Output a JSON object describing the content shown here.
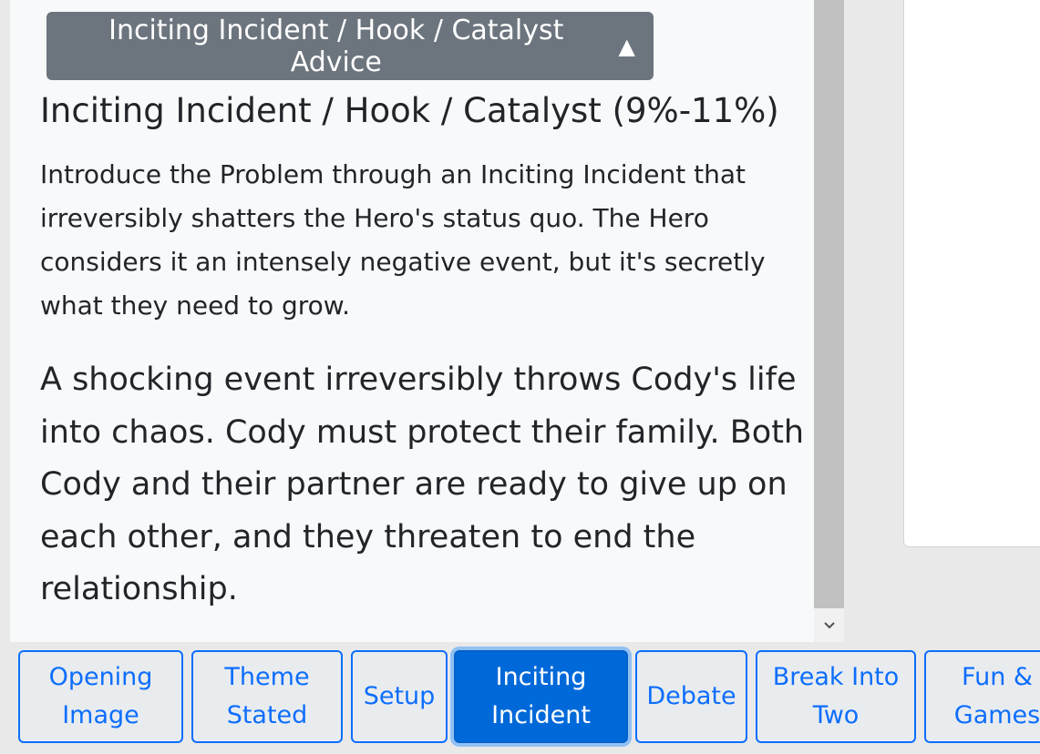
{
  "advice": {
    "button_label": "Inciting Incident / Hook / Catalyst Advice",
    "toggle_icon": "▲"
  },
  "section": {
    "heading": "Inciting Incident / Hook / Catalyst (9%-11%)",
    "description": "Introduce the Problem through an Inciting Incident that irreversibly shatters the Hero's status quo. The Hero considers it an intensely negative event, but it's secretly what they need to grow.",
    "story_text": "A shocking event irreversibly throws Cody's life into chaos. Cody must protect their family. Both Cody and their partner are ready to give up on each other, and they threaten to end the relationship."
  },
  "scrollbar": {
    "down_arrow": "⌄"
  },
  "beats": [
    {
      "label": "Opening Image",
      "active": false
    },
    {
      "label": "Theme Stated",
      "active": false
    },
    {
      "label": "Setup",
      "active": false
    },
    {
      "label": "Inciting Incident",
      "active": true
    },
    {
      "label": "Debate",
      "active": false
    },
    {
      "label": "Break Into Two",
      "active": false
    },
    {
      "label": "Fun & Games",
      "active": false
    }
  ],
  "colors": {
    "primary": "#0d6efd",
    "active_beat": "#0069d9",
    "advice_button": "#6c757d"
  }
}
